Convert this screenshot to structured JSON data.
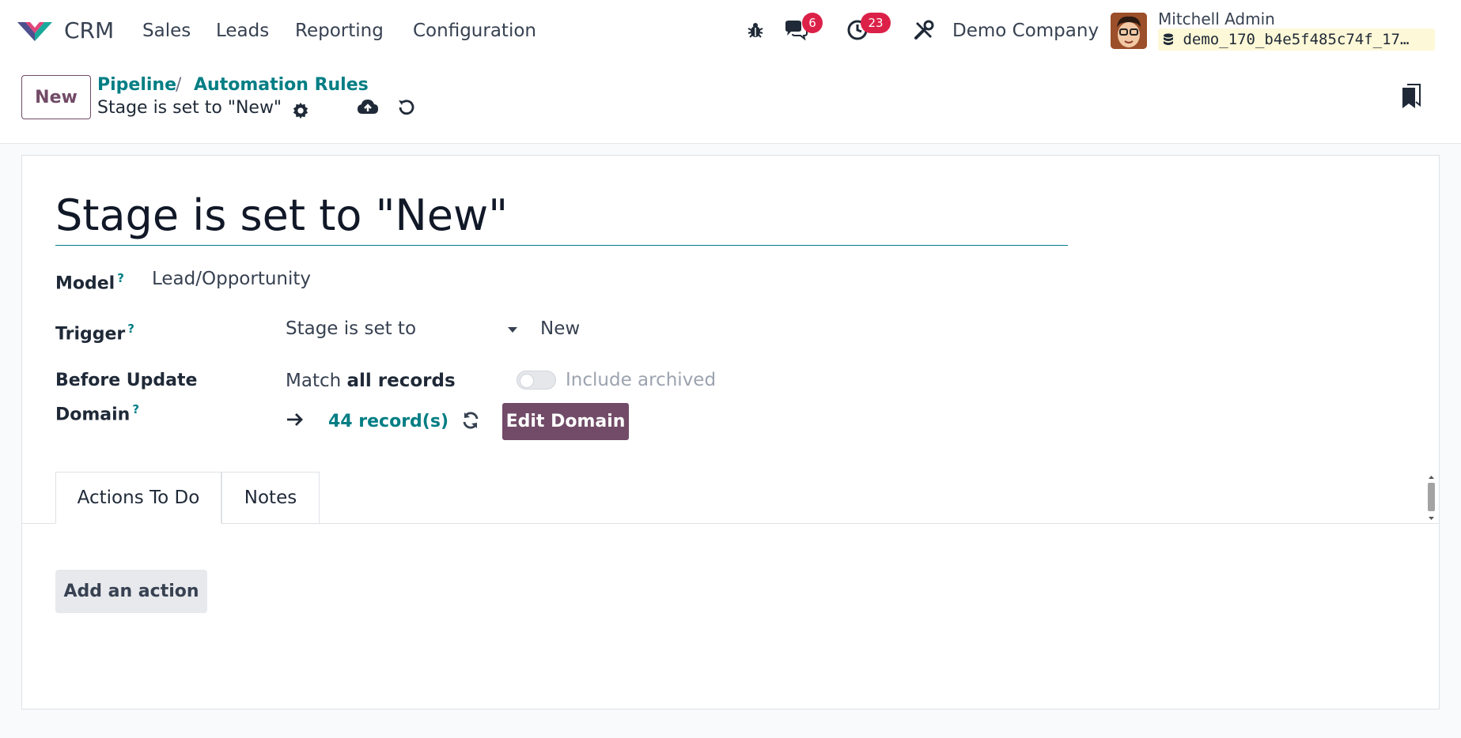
{
  "navbar": {
    "app_name": "CRM",
    "menu": [
      "Sales",
      "Leads",
      "Reporting",
      "Configuration"
    ],
    "messages_count": "6",
    "activities_count": "23",
    "company": "Demo Company",
    "user_name": "Mitchell Admin",
    "database": "demo_170_b4e5f485c74f_17…"
  },
  "control_panel": {
    "new_label": "New",
    "breadcrumb": [
      "Pipeline",
      "Automation Rules"
    ],
    "breadcrumb_sep": "/",
    "current_record": "Stage is set to \"New\""
  },
  "form": {
    "title": "Stage is set to \"New\"",
    "model_label": "Model",
    "model_value": "Lead/Opportunity",
    "trigger_label": "Trigger",
    "trigger_value": "Stage is set to",
    "trigger_stage": "New",
    "domain_label_1": "Before Update",
    "domain_label_2": "Domain",
    "help_mark": "?",
    "match_prefix": "Match",
    "match_bold": "all records",
    "include_archived": "Include archived",
    "records_count": "44 record(s)",
    "edit_domain": "Edit Domain",
    "tabs": [
      "Actions To Do",
      "Notes"
    ],
    "add_action": "Add an action"
  },
  "colors": {
    "primary": "#714b67",
    "link": "#017e84",
    "badge": "#dc2148"
  }
}
